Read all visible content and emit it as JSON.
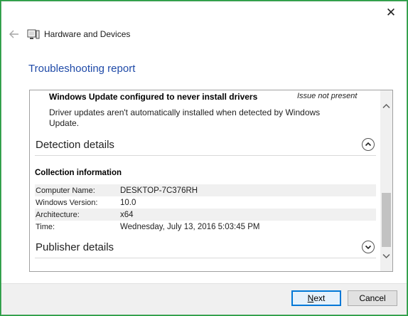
{
  "window": {
    "close_glyph": "✕"
  },
  "nav": {
    "back_icon": "back-arrow-icon",
    "app_icon": "hardware-devices-icon",
    "title": "Hardware and Devices"
  },
  "page": {
    "title": "Troubleshooting report"
  },
  "issue": {
    "title": "Windows Update configured to never install drivers",
    "status": "Issue not present",
    "description": "Driver updates aren't automatically installed when detected by Windows Update."
  },
  "detection": {
    "header": "Detection details",
    "expanded": true,
    "collection_title": "Collection information",
    "rows": [
      {
        "key": "Computer Name:",
        "value": "DESKTOP-7C376RH"
      },
      {
        "key": "Windows Version:",
        "value": "10.0"
      },
      {
        "key": "Architecture:",
        "value": "x64"
      },
      {
        "key": "Time:",
        "value": "Wednesday, July 13, 2016 5:03:45 PM"
      }
    ]
  },
  "publisher": {
    "header": "Publisher details",
    "expanded": false
  },
  "footer": {
    "next_access_key": "N",
    "next_rest": "ext",
    "cancel_label": "Cancel"
  },
  "colors": {
    "title_blue": "#1f4aa8",
    "accent": "#0078d7",
    "window_border": "#1e9e3c"
  }
}
